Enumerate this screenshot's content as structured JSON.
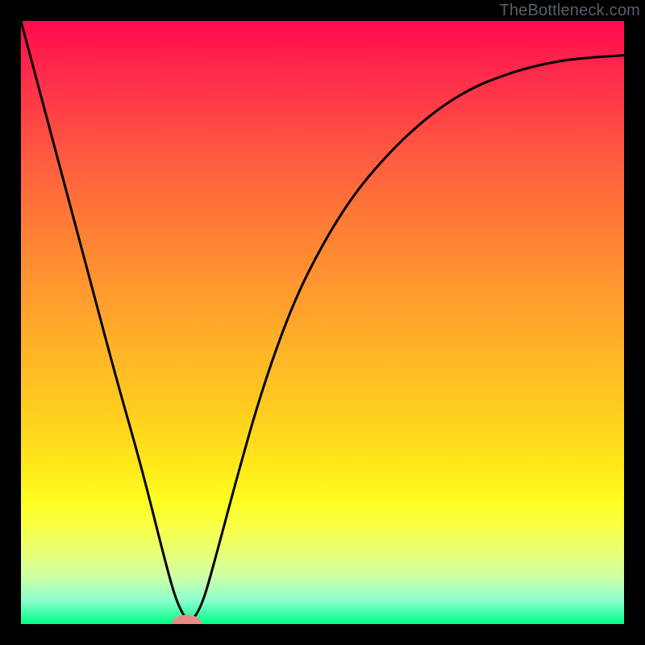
{
  "watermark": "TheBottleneck.com",
  "colors": {
    "page_bg": "#000000",
    "curve_stroke": "#000000",
    "marker_fill": "#e98b87",
    "gradient_top": "#ff0b50",
    "gradient_bottom": "#00ff89"
  },
  "chart_data": {
    "type": "line",
    "title": "",
    "xlabel": "",
    "ylabel": "",
    "xlim": [
      0,
      100
    ],
    "ylim": [
      0,
      100
    ],
    "grid": false,
    "legend": false,
    "series": [
      {
        "name": "bottleneck-curve",
        "x": [
          0,
          4,
          8,
          12,
          16,
          20,
          24,
          26,
          28,
          30,
          32,
          36,
          40,
          45,
          50,
          55,
          60,
          65,
          70,
          75,
          80,
          85,
          90,
          95,
          100
        ],
        "values": [
          100,
          85,
          70,
          55,
          40,
          26,
          10,
          3,
          0,
          3,
          10,
          25,
          39,
          53,
          63,
          71,
          77,
          82,
          86,
          89,
          91,
          92.5,
          93.5,
          94,
          94.3
        ]
      }
    ],
    "marker": {
      "x": 27.5,
      "y": 0,
      "rx": 2.5,
      "ry": 1
    }
  }
}
